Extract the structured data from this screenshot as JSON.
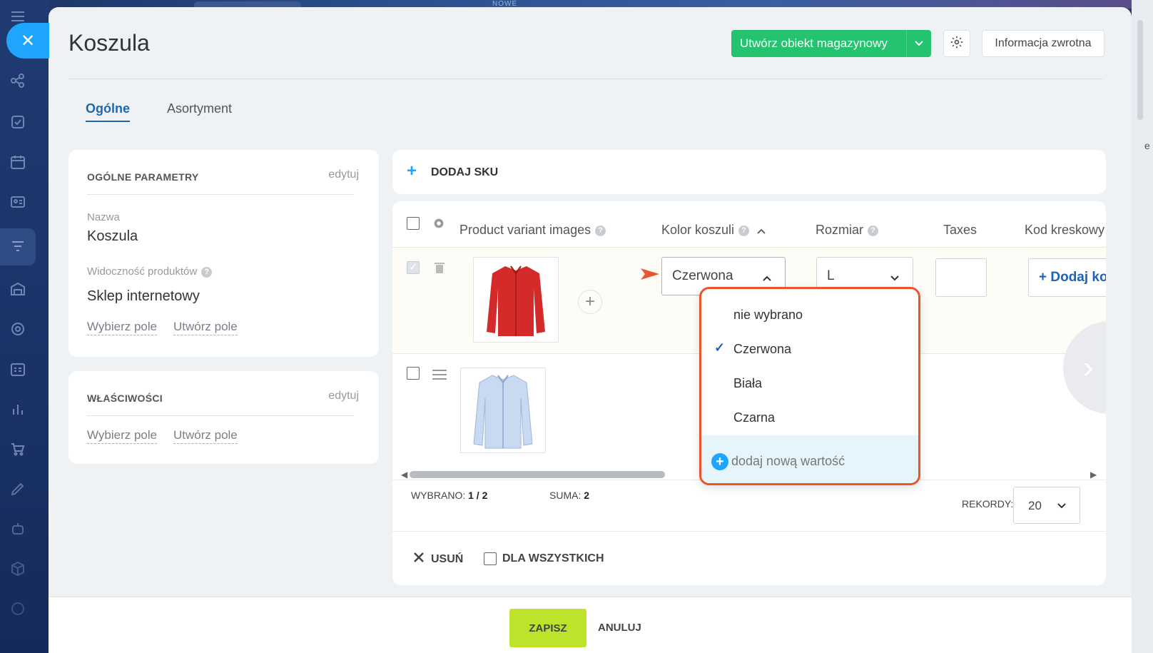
{
  "background": {
    "badge": "NOWE"
  },
  "sidebar": {
    "icons": [
      "menu-icon",
      "share-nodes-icon",
      "task-check-icon",
      "calendar-icon",
      "contact-card-icon",
      "funnel-icon",
      "warehouse-icon",
      "target-icon",
      "planner-icon",
      "bar-chart-icon",
      "cart-icon",
      "pen-icon",
      "robot-icon",
      "cube-icon",
      "help-icon"
    ]
  },
  "header": {
    "title": "Koszula",
    "create_button": "Utwórz obiekt magazynowy",
    "feedback_button": "Informacja zwrotna"
  },
  "tabs": [
    "Ogólne",
    "Asortyment"
  ],
  "general_card": {
    "heading": "OGÓLNE PARAMETRY",
    "edit": "edytuj",
    "name_label": "Nazwa",
    "name_value": "Koszula",
    "visibility_label": "Widoczność produktów",
    "visibility_value": "Sklep internetowy",
    "choose_field": "Wybierz pole",
    "create_field": "Utwórz pole"
  },
  "properties_card": {
    "heading": "WŁAŚCIWOŚCI",
    "edit": "edytuj",
    "choose_field": "Wybierz pole",
    "create_field": "Utwórz pole"
  },
  "sku": {
    "add_label": "DODAJ SKU"
  },
  "table": {
    "columns": [
      "Product variant images",
      "Kolor koszuli",
      "Rozmiar",
      "Taxes",
      "Kod kreskowy"
    ],
    "rows": [
      {
        "color": "Czerwona",
        "size": "L",
        "barcode_button": "+ Dodaj kod"
      }
    ],
    "selected_label": "WYBRANO:",
    "selected_value": "1 / 2",
    "total_label": "SUMA:",
    "total_value": "2",
    "records_label": "REKORDY:",
    "records_value": "20",
    "delete_label": "USUŃ",
    "for_all_label": "DLA WSZYSTKICH"
  },
  "dropdown": {
    "options": [
      "nie wybrano",
      "Czerwona",
      "Biała",
      "Czarna"
    ],
    "selected": "Czerwona",
    "add_new": "dodaj nową wartość"
  },
  "footer": {
    "save": "ZAPISZ",
    "cancel": "ANULUJ"
  },
  "colors": {
    "accent_green": "#23c36f",
    "save_lime": "#bde32a",
    "link_blue": "#2067b0",
    "highlight_border": "#e8562f",
    "shirt_red": "#d42a2a",
    "shirt_blue": "#c8daf2"
  }
}
